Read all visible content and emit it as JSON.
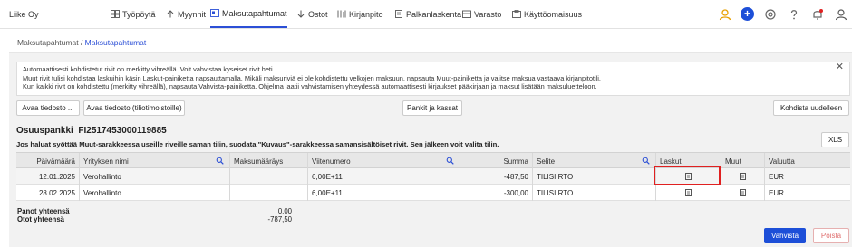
{
  "company": "Liike Oy",
  "nav": {
    "items": [
      {
        "label": "Työpöytä",
        "icon": "dashboard-icon"
      },
      {
        "label": "Myynnit",
        "icon": "arrow-up-icon"
      },
      {
        "label": "Maksutapahtumat",
        "icon": "payments-icon",
        "active": true
      },
      {
        "label": "Ostot",
        "icon": "arrow-down-icon"
      },
      {
        "label": "Kirjanpito",
        "icon": "ledger-icon"
      },
      {
        "label": "Palkanlaskenta",
        "icon": "payroll-icon"
      },
      {
        "label": "Varasto",
        "icon": "warehouse-icon"
      },
      {
        "label": "Käyttöomaisuus",
        "icon": "assets-icon"
      }
    ],
    "right_icons": [
      "user-icon",
      "plus-icon",
      "settings-icon",
      "help-icon",
      "notification-icon",
      "profile-icon"
    ],
    "plus_label": "+"
  },
  "breadcrumb": {
    "parent": "Maksutapahtumat",
    "separator": " / ",
    "current": "Maksutapahtumat"
  },
  "info": {
    "lines": [
      "Automaattisesti kohdistetut rivit on merkitty vihreällä. Voit vahvistaa kyseiset rivit heti.",
      "Muut rivit tulisi kohdistaa laskuihin käsin Laskut-painiketta napsauttamalla. Mikäli maksuriviä ei ole kohdistettu velkojen maksuun, napsauta Muut-painiketta ja valitse maksua vastaava kirjanpitotili.",
      "Kun kaikki rivit on kohdistettu (merkitty vihreällä), napsauta Vahvista-painiketta. Ohjelma laatii vahvistamisen yhteydessä automaattisesti kirjaukset pääkirjaan ja maksut lisätään maksuluetteloon."
    ],
    "close": "✕"
  },
  "buttons": {
    "open_file": "Avaa tiedosto ...",
    "open_file_statement": "Avaa tiedosto (tiliotimoistoille)",
    "banks": "Pankit ja kassat",
    "reallocate": "Kohdista uudelleen",
    "xls": "XLS",
    "confirm": "Vahvista",
    "delete": "Poista"
  },
  "bank": {
    "name": "Osuuspankki",
    "iban": "FI2517453000119885"
  },
  "hint": "Jos haluat syöttää Muut-sarakkeessa useille riveille saman tilin, suodata \"Kuvaus\"-sarakkeessa samansisältöiset rivit. Sen jälkeen voit valita tilin.",
  "table": {
    "headers": [
      "Päivämäärä",
      "Yrityksen nimi",
      "Maksumääräys",
      "Viitenumero",
      "Summa",
      "Selite",
      "Laskut",
      "Muut",
      "Valuutta"
    ],
    "rows": [
      {
        "date": "12.01.2025",
        "company": "Verohallinto",
        "order": "",
        "ref": "6,00E+11",
        "sum": "-487,50",
        "desc": "TILISIIRTO",
        "currency": "EUR"
      },
      {
        "date": "28.02.2025",
        "company": "Verohallinto",
        "order": "",
        "ref": "6,00E+11",
        "sum": "-300,00",
        "desc": "TILISIIRTO",
        "currency": "EUR"
      }
    ]
  },
  "totals": {
    "in_label": "Panot yhteensä",
    "out_label": "Otot yhteensä",
    "in_value": "0,00",
    "out_value": "-787,50"
  },
  "colors": {
    "accent": "#1d4fd8",
    "highlight": "#e02020"
  }
}
